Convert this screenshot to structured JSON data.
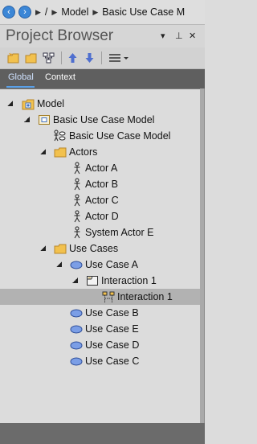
{
  "breadcrumb": {
    "back_icon": "arrow-left-icon",
    "forward_icon": "arrow-right-icon",
    "items": [
      "/",
      "Model",
      "Basic Use Case M"
    ]
  },
  "panel": {
    "title": "Project Browser",
    "controls": {
      "menu": "▾",
      "pin": "⊥",
      "close": "✕"
    }
  },
  "tabs": [
    {
      "label": "Global",
      "active": true
    },
    {
      "label": "Context",
      "active": false
    }
  ],
  "tree": {
    "root": "Model",
    "package": "Basic Use Case Model",
    "diagram": "Basic Use Case Model",
    "actors_folder": "Actors",
    "actors": [
      "Actor A",
      "Actor B",
      "Actor C",
      "Actor D",
      "System Actor E"
    ],
    "usecases_folder": "Use Cases",
    "use_case_a": "Use Case A",
    "interaction_parent": "Interaction 1",
    "interaction_child": "Interaction 1",
    "other_use_cases": [
      "Use Case B",
      "Use Case E",
      "Use Case D",
      "Use Case C"
    ]
  },
  "colors": {
    "accent": "#3b86d6",
    "folder": "#f2c14e",
    "usecase": "#7b9ee6",
    "selected_row": "#b2b2b2"
  }
}
